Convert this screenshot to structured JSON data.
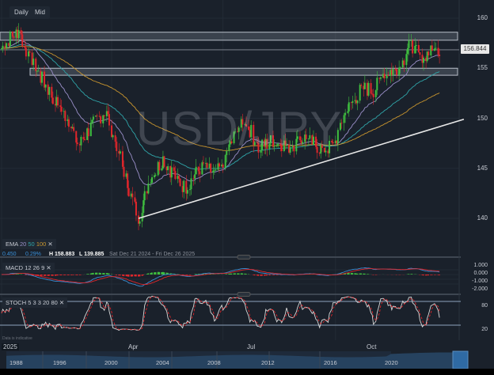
{
  "toolbar": {
    "daily": "Daily",
    "mid": "Mid"
  },
  "watermark": "USD/JPY",
  "current_price": "156.844",
  "ema_legend": {
    "name": "EMA",
    "p1": "20",
    "p2": "50",
    "p3": "100"
  },
  "stats": {
    "change": "0.450",
    "pct": "0.29%",
    "high": "H 158.883",
    "low": "L 139.885",
    "range": "Sat Dec 21 2024 - Fri Dec 26 2025"
  },
  "macd_legend": {
    "name": "MACD",
    "p1": "12",
    "p2": "26",
    "p3": "9"
  },
  "stoch_legend": {
    "name": "STOCH",
    "p1": "5",
    "p2": "3",
    "p3": "3",
    "p4": "20",
    "p5": "80"
  },
  "disclaimer": "Data is indicative",
  "x_labels": [
    "2025",
    "Apr",
    "Jul",
    "Oct"
  ],
  "navigator_labels": [
    "1988",
    "1996",
    "2000",
    "2004",
    "2008",
    "2012",
    "2016",
    "2020"
  ],
  "colors": {
    "up": "#3fbf3f",
    "down": "#e0262b",
    "ema20": "#9a8fc8",
    "ema50": "#2fa4a8",
    "ema100": "#c8952e",
    "macd": "#3b8fd6",
    "signal": "#e0262b",
    "bg": "#1a212b"
  },
  "chart_data": {
    "type": "candlestick",
    "title": "USD/JPY",
    "timeframe": "Daily",
    "y_ticks": [
      160,
      155,
      150,
      145,
      140
    ],
    "macd_ticks": [
      "1.000",
      "0.000",
      "-1.000",
      "-2.000"
    ],
    "stoch_ticks": [
      "80",
      "20"
    ],
    "ylim": [
      136,
      161.8
    ],
    "keypoints_day_price": [
      [
        0,
        157
      ],
      [
        8,
        158.2
      ],
      [
        14,
        158.8
      ],
      [
        22,
        156
      ],
      [
        35,
        153.5
      ],
      [
        45,
        151.5
      ],
      [
        55,
        149.8
      ],
      [
        63,
        147.2
      ],
      [
        72,
        149
      ],
      [
        85,
        150.8
      ],
      [
        95,
        147
      ],
      [
        105,
        142.5
      ],
      [
        112,
        140
      ],
      [
        120,
        143.5
      ],
      [
        132,
        146
      ],
      [
        140,
        144.5
      ],
      [
        150,
        143
      ],
      [
        165,
        145.5
      ],
      [
        175,
        144.2
      ],
      [
        188,
        147.5
      ],
      [
        198,
        150.2
      ],
      [
        210,
        147
      ],
      [
        222,
        147.8
      ],
      [
        235,
        147.2
      ],
      [
        248,
        148
      ],
      [
        262,
        146.9
      ],
      [
        272,
        147.2
      ],
      [
        278,
        149.8
      ],
      [
        286,
        151.5
      ],
      [
        295,
        153
      ],
      [
        305,
        152.8
      ],
      [
        312,
        154.5
      ],
      [
        320,
        154.8
      ],
      [
        327,
        155.2
      ],
      [
        333,
        157.5
      ],
      [
        341,
        156.2
      ],
      [
        359,
        156.844
      ]
    ],
    "zones": [
      [
        157.8,
        158.6
      ],
      [
        154.3,
        155.0
      ]
    ],
    "level": 156.844,
    "trendline": [
      [
        112,
        140
      ],
      [
        365,
        149.2
      ]
    ]
  }
}
